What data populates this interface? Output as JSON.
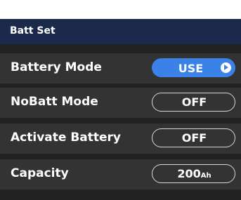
{
  "title": "Batt Set",
  "rows": [
    {
      "label": "Battery Mode",
      "value": "USE",
      "state": "active"
    },
    {
      "label": "NoBatt Mode",
      "value": "OFF"
    },
    {
      "label": "Activate Battery",
      "value": "OFF"
    },
    {
      "label": "Capacity",
      "value": "200",
      "unit": "Ah"
    }
  ],
  "colors": {
    "title_bar": "#1b2a4a",
    "row_background": "#333333",
    "screen_background": "#222222",
    "accent": "#3b82e8"
  },
  "icons": {
    "battery_mode_indicator": "play-circle-icon"
  }
}
